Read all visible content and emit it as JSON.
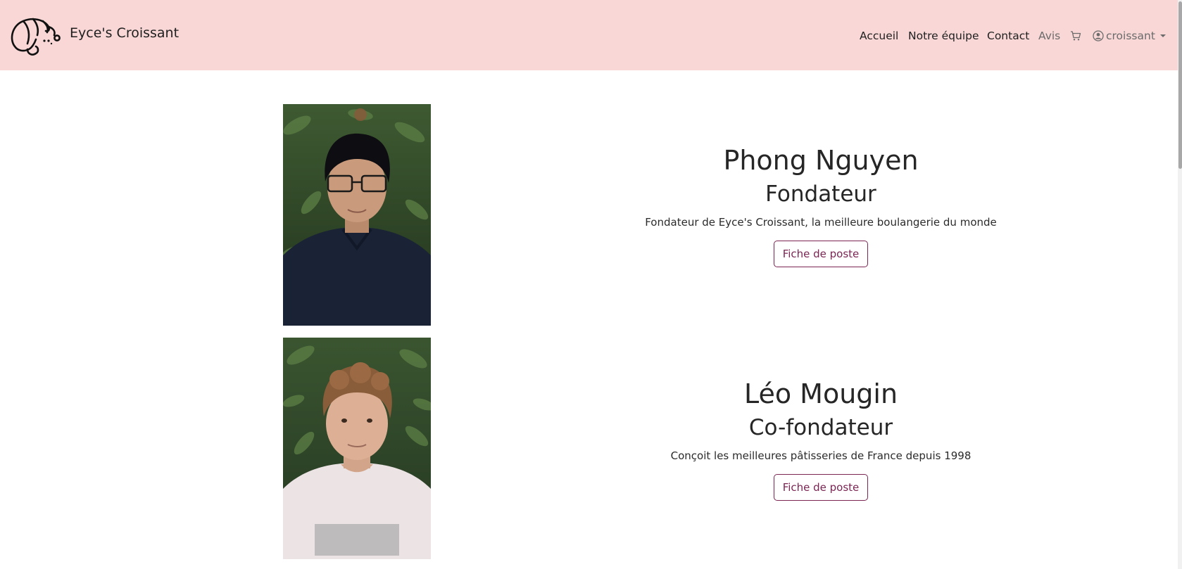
{
  "brand": {
    "name": "Eyce's Croissant",
    "logo_icon": "croissant-icon"
  },
  "nav": {
    "items": [
      {
        "label": "Accueil"
      },
      {
        "label": "Notre équipe"
      },
      {
        "label": "Contact"
      },
      {
        "label": "Avis"
      }
    ],
    "cart_icon": "cart-icon",
    "user": {
      "icon": "user-circle-icon",
      "label": "croissant",
      "caret_icon": "caret-down-icon"
    }
  },
  "team": [
    {
      "name": "Phong Nguyen",
      "role": "Fondateur",
      "description": "Fondateur de Eyce's Croissant, la meilleure boulangerie du monde",
      "button_label": "Fiche de poste"
    },
    {
      "name": "Léo Mougin",
      "role": "Co-fondateur",
      "description": "Conçoit les meilleures pâtisseries de France depuis 1998",
      "button_label": "Fiche de poste"
    }
  ],
  "colors": {
    "navbar_bg": "#f8d7d6",
    "button_accent": "#7b2553",
    "text": "#262626"
  }
}
